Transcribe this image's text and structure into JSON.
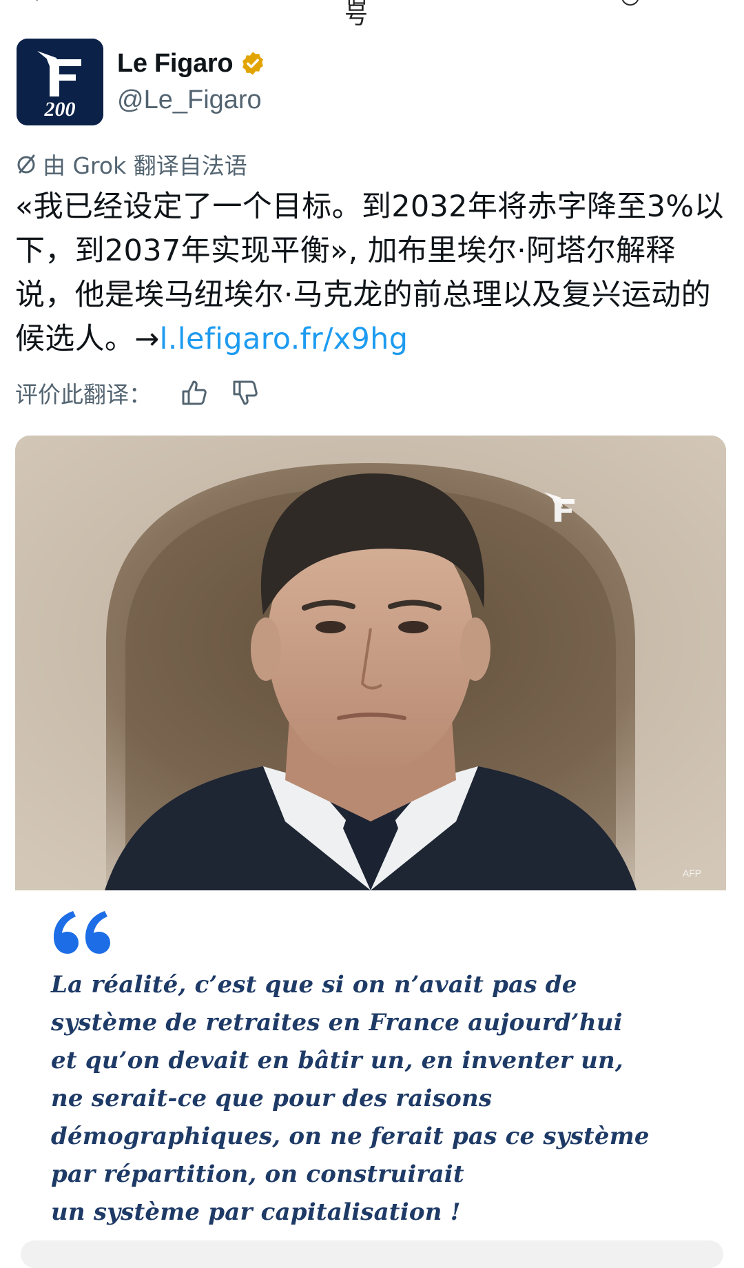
{
  "status_fragments": {
    "left": "‹",
    "mid": "信号",
    "right": "◔"
  },
  "account": {
    "display_name": "Le Figaro",
    "handle": "@Le_Figaro",
    "verified": true,
    "verified_color": "#e2a400",
    "avatar_bg": "#0b2147",
    "avatar_text": "200"
  },
  "translation": {
    "label": "由 Grok 翻译自法语",
    "icon": "translate-icon"
  },
  "tweet": {
    "text": "«我已经设定了一个目标。到2032年将赤字降至3%以下，到2037年实现平衡», 加布里埃尔·阿塔尔解释说，他是埃马纽埃尔·马克龙的前总理以及复兴运动的候选人。→",
    "link_text": "l.lefigaro.fr/x9hg",
    "link_color": "#1d9bf0"
  },
  "rate_translation": {
    "label": "评价此翻译：",
    "thumbs_up_icon": "thumbs-up-icon",
    "thumbs_down_icon": "thumbs-down-icon"
  },
  "media": {
    "photo_credit": "AFP",
    "quote_color": "#1e3a66",
    "quote_mark_color": "#1d6ee6",
    "quote_lines": [
      "La réalité, c’est que si on n’avait pas de",
      "système de retraites en France aujourd’hui",
      "et qu’on devait en bâtir un, en inventer un,",
      "ne serait-ce que pour des raisons",
      "démographiques, on ne ferait pas ce système",
      "par répartition, on construirait",
      "un système par capitalisation !"
    ]
  }
}
